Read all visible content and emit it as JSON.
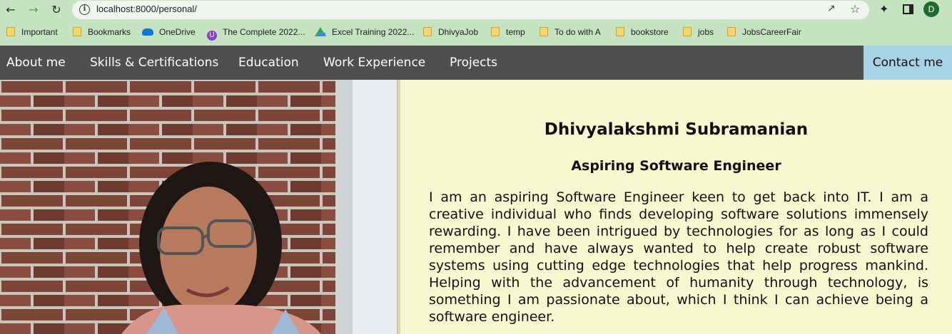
{
  "browser": {
    "url": "localhost:8000/personal/",
    "avatar_letter": "D",
    "bookmarks": [
      {
        "label": "Important",
        "icon": "folder-icon"
      },
      {
        "label": "Bookmarks",
        "icon": "folder-icon"
      },
      {
        "label": "OneDrive",
        "icon": "cloud-icon"
      },
      {
        "label": "The Complete 2022...",
        "icon": "course-icon"
      },
      {
        "label": "Excel Training 2022...",
        "icon": "drive-icon"
      },
      {
        "label": "DhivyaJob",
        "icon": "folder-icon"
      },
      {
        "label": "temp",
        "icon": "folder-icon"
      },
      {
        "label": "To do with A",
        "icon": "folder-icon"
      },
      {
        "label": "bookstore",
        "icon": "folder-icon"
      },
      {
        "label": "jobs",
        "icon": "folder-icon"
      },
      {
        "label": "JobsCareerFair",
        "icon": "folder-icon"
      }
    ]
  },
  "nav": {
    "items": [
      "About me",
      "Skills & Certifications",
      "Education",
      "Work Experience",
      "Projects"
    ],
    "contact": "Contact me"
  },
  "profile": {
    "name": "Dhivyalakshmi Subramanian",
    "role": "Aspiring Software Engineer",
    "bio": "I am an aspiring Software Engineer keen to get back into IT. I am a creative individual who finds developing software solutions immensely rewarding. I have been intrigued by technologies for as long as I could remember and have always wanted to help create robust software systems using cutting edge technologies that help progress mankind. Helping with the advancement of humanity through technology, is something I am passionate about, which I think I can achieve being a software engineer."
  },
  "colors": {
    "browser_frame": "#c5e3c0",
    "nav_bg": "#4f4f4f",
    "contact_bg": "#a8d2e6",
    "text_panel_bg": "#f7f8cf"
  }
}
